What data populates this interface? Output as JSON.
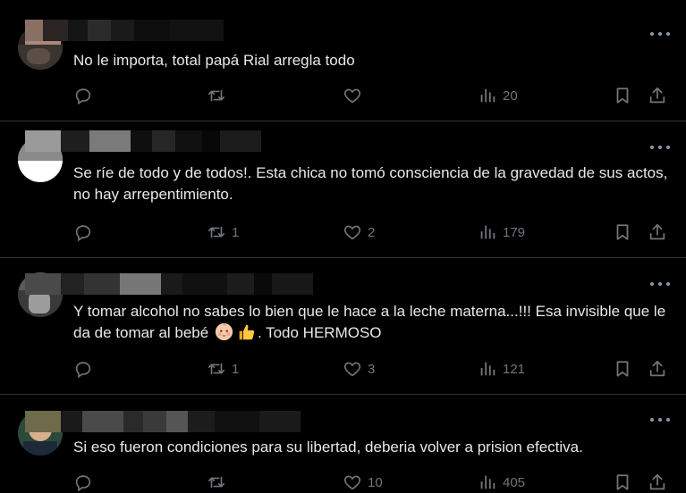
{
  "posts": [
    {
      "text": "No le importa, total papá Rial arregla todo",
      "reply_count": "",
      "repost_count": "",
      "like_count": "",
      "views_count": "20"
    },
    {
      "text": "Se ríe de todo y de todos!. Esta chica no tomó consciencia de la gravedad de sus actos,  no hay arrepentimiento.",
      "reply_count": "",
      "repost_count": "1",
      "like_count": "2",
      "views_count": "179"
    },
    {
      "text_before_emoji": "Y tomar alcohol no sabes lo bien que le hace a la leche materna...!!! Esa invisible que le da de tomar al bebé ",
      "text_after_emoji": ". Todo HERMOSO",
      "emoji": [
        "baby-emoji",
        "thumbs-up-emoji"
      ],
      "reply_count": "",
      "repost_count": "1",
      "like_count": "3",
      "views_count": "121"
    },
    {
      "text": "Si eso fueron condiciones para su libertad, deberia volver a prision efectiva.",
      "reply_count": "",
      "repost_count": "",
      "like_count": "10",
      "views_count": "405"
    }
  ],
  "icons": {
    "reply": "reply-icon",
    "repost": "repost-icon",
    "like": "heart-icon",
    "views": "views-icon",
    "bookmark": "bookmark-icon",
    "share": "share-icon",
    "more": "more-icon"
  },
  "colors": {
    "background": "#000000",
    "text": "#e7e9ea",
    "icon": "#71767b",
    "divider": "#2f3336"
  }
}
